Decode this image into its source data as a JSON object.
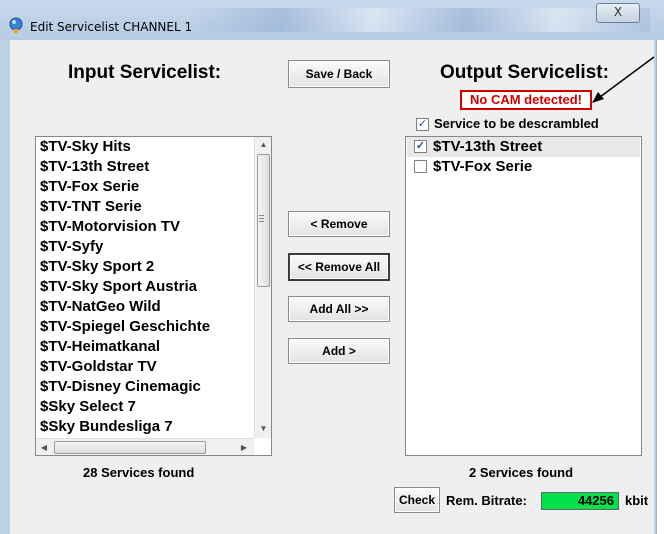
{
  "window": {
    "title": "Edit Servicelist CHANNEL 1",
    "close_label": "X"
  },
  "input": {
    "heading": "Input Servicelist:",
    "items": [
      "$TV-Sky Hits",
      "$TV-13th Street",
      "$TV-Fox Serie",
      "$TV-TNT Serie",
      "$TV-Motorvision TV",
      "$TV-Syfy",
      "$TV-Sky Sport 2",
      "$TV-Sky Sport Austria",
      "$TV-NatGeo Wild",
      "$TV-Spiegel Geschichte",
      "$TV-Heimatkanal",
      "$TV-Goldstar TV",
      "$TV-Disney Cinemagic",
      "$Sky Select 7",
      "$Sky Bundesliga 7"
    ],
    "count_text": "28 Services found"
  },
  "actions": {
    "save_back": "Save / Back",
    "remove": "< Remove",
    "remove_all": "<< Remove All",
    "add_all": "Add All >>",
    "add": "Add >"
  },
  "output": {
    "heading": "Output Servicelist:",
    "no_cam": "No CAM detected!",
    "descramble_label": "Service to be descrambled",
    "descramble_checked": true,
    "items": [
      {
        "label": "$TV-13th Street",
        "checked": true
      },
      {
        "label": "$TV-Fox Serie",
        "checked": false
      }
    ],
    "count_text": "2 Services found"
  },
  "footer": {
    "check_label": "Check",
    "rem_bitrate_label": "Rem. Bitrate:",
    "bitrate_value": "44256",
    "bitrate_unit": "kbit"
  },
  "colors": {
    "no_cam": "#d00000",
    "bitrate_bg": "#00e24a",
    "checkmark": "#2a4aa0"
  }
}
